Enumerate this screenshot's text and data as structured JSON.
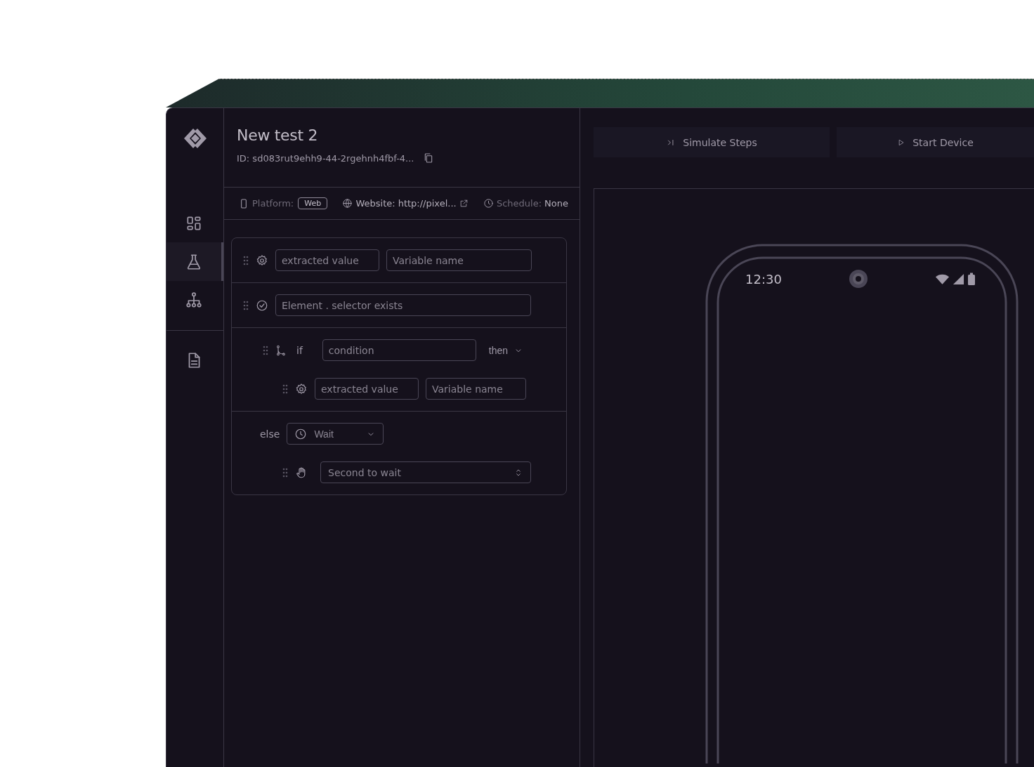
{
  "sidebar": {
    "nav": [
      {
        "kind": "dashboard",
        "selected": false
      },
      {
        "kind": "flask",
        "selected": true
      },
      {
        "kind": "hierarchy",
        "selected": false
      }
    ],
    "bottom_nav": [
      {
        "kind": "document",
        "selected": false
      }
    ]
  },
  "editor": {
    "title": "New test 2",
    "id": "ID: sd083rut9ehh9-44-2rgehnh4fbf-4...",
    "meta": [
      {
        "kind": "platform",
        "label": "Platform:",
        "value": "Web"
      },
      {
        "kind": "website",
        "label": "Website:",
        "value": "http://pixel..."
      },
      {
        "kind": "schedule",
        "label": "Schedule:",
        "value": "None"
      }
    ],
    "steps": [
      {
        "kind": "extract",
        "placeholder": "extracted value",
        "variable_placeholder": "Variable name"
      },
      {
        "kind": "assert",
        "placeholder": "Element . selector exists"
      },
      {
        "kind": "if",
        "keyword": "if",
        "placeholder": "condition",
        "then_label": "then",
        "children": [
          {
            "kind": "extract",
            "placeholder": "extracted value",
            "variable_placeholder": "Variable name"
          }
        ]
      },
      {
        "kind": "else",
        "keyword": "else",
        "select": "Wait",
        "children": [
          {
            "kind": "wait",
            "placeholder": "Second to wait"
          }
        ]
      }
    ]
  },
  "preview": {
    "buttons": [
      {
        "kind": "simulate",
        "label": "Simulate Steps"
      },
      {
        "kind": "start",
        "label": "Start Device"
      }
    ],
    "phone": {
      "time": "12:30"
    }
  }
}
